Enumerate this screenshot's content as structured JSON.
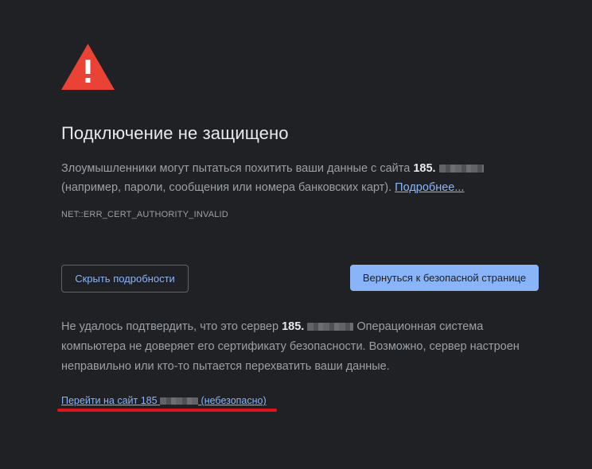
{
  "heading": "Подключение не защищено",
  "intro": {
    "text_before": "Злоумышленники могут пытаться похитить ваши данные с сайта ",
    "host_prefix": "185.",
    "text_after": "(например, пароли, сообщения или номера банковских карт).",
    "learn_more": "Подробнее..."
  },
  "error_code": "NET::ERR_CERT_AUTHORITY_INVALID",
  "buttons": {
    "details": "Скрыть подробности",
    "back": "Вернуться к безопасной странице"
  },
  "details": {
    "text_before": "Не удалось подтвердить, что это сервер ",
    "host_prefix": "185.",
    "text_after": " Операционная система компьютера не доверяет его сертификату безопасности. Возможно, сервер настроен неправильно или кто-то пытается перехватить ваши данные."
  },
  "proceed": {
    "prefix": "Перейти на сайт 185",
    "suffix": "(небезопасно)"
  },
  "colors": {
    "background": "#202124",
    "warning": "#ea4335",
    "link": "#8ab4f8",
    "annotation": "#e0141e"
  }
}
